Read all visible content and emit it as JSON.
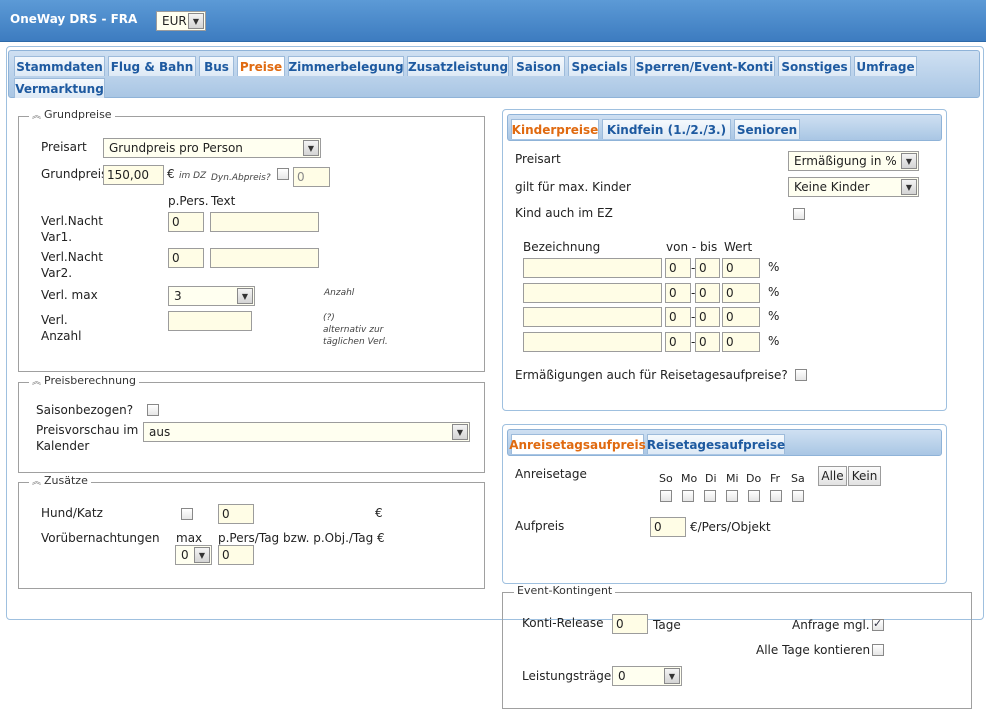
{
  "app": {
    "title": "OneWay DRS - FRA",
    "currency": "EUR"
  },
  "tabs": [
    {
      "label": "Stammdaten"
    },
    {
      "label": "Flug & Bahn"
    },
    {
      "label": "Bus"
    },
    {
      "label": "Preise",
      "active": true
    },
    {
      "label": "Zimmerbelegung"
    },
    {
      "label": "Zusatzleistung"
    },
    {
      "label": "Saison"
    },
    {
      "label": "Specials"
    },
    {
      "label": "Sperren/Event-Konti"
    },
    {
      "label": "Sonstiges"
    },
    {
      "label": "Umfrage"
    },
    {
      "label": "Vermarktung"
    }
  ],
  "grundpreise": {
    "legend": "Grundpreise",
    "preisart_label": "Preisart",
    "preisart_value": "Grundpreis pro Person",
    "grundpreis_label": "Grundpreis",
    "grundpreis_value": "150,00",
    "euro": "€",
    "im_dz": "im DZ",
    "dyn_label": "Dyn.Abpreis?",
    "dyn_value": "0",
    "col_ppers": "p.Pers.",
    "col_text": "Text",
    "var1_label_1": "Verl.Nacht",
    "var1_label_2": "Var1.",
    "var1_value": "0",
    "var2_label_1": "Verl.Nacht",
    "var2_label_2": "Var2.",
    "var2_value": "0",
    "verlmax_label": "Verl. max",
    "verlmax_value": "3",
    "anzahl_hint": "Anzahl",
    "verlanz_label_1": "Verl.",
    "verlanz_label_2": "Anzahl",
    "alt_hint_1": "(?)",
    "alt_hint_2": "alternativ zur",
    "alt_hint_3": "täglichen Verl."
  },
  "preisberechnung": {
    "legend": "Preisberechnung",
    "saison_label": "Saisonbezogen?",
    "vorschau_label_1": "Preisvorschau im",
    "vorschau_label_2": "Kalender",
    "vorschau_value": "aus"
  },
  "zusaetze": {
    "legend": "Zusätze",
    "hund_label": "Hund/Katz",
    "hund_value": "0",
    "euro": "€",
    "vor_label": "Vorübernachtungen",
    "max_label": "max",
    "max_value": "0",
    "per_label": "p.Pers/Tag bzw. p.Obj./Tag €",
    "per_value": "0"
  },
  "kinder": {
    "tabs": [
      {
        "label": "Kinderpreise",
        "active": true
      },
      {
        "label": "Kindfein (1./2./3.)"
      },
      {
        "label": "Senioren"
      }
    ],
    "preisart_label": "Preisart",
    "preisart_value": "Ermäßigung in %",
    "maxkinder_label": "gilt für max. Kinder",
    "maxkinder_value": "Keine Kinder",
    "ez_label": "Kind auch im EZ",
    "col_bez": "Bezeichnung",
    "col_vonbis": "von - bis",
    "col_wert": "Wert",
    "rows": [
      {
        "von": "0",
        "bis": "0",
        "wert": "0",
        "unit": "%"
      },
      {
        "von": "0",
        "bis": "0",
        "wert": "0",
        "unit": "%"
      },
      {
        "von": "0",
        "bis": "0",
        "wert": "0",
        "unit": "%"
      },
      {
        "von": "0",
        "bis": "0",
        "wert": "0",
        "unit": "%"
      }
    ],
    "reise_label": "Ermäßigungen auch für Reisetagesaufpreise?"
  },
  "anreise": {
    "tabs": [
      {
        "label": "Anreisetagsaufpreis",
        "active": true
      },
      {
        "label": "Reisetagesaufpreise"
      }
    ],
    "tage_label": "Anreisetage",
    "days": [
      "So",
      "Mo",
      "Di",
      "Mi",
      "Do",
      "Fr",
      "Sa"
    ],
    "alle": "Alle",
    "kein": "Kein",
    "aufpreis_label": "Aufpreis",
    "aufpreis_value": "0",
    "aufpreis_unit": "€/Pers/Objekt"
  },
  "event": {
    "legend": "Event-Kontingent",
    "release_label": "Konti-Release",
    "release_value": "0",
    "tage": "Tage",
    "anfrage_label": "Anfrage mgl.",
    "alle_tage_label": "Alle Tage kontieren",
    "traeger_label": "Leistungsträger",
    "traeger_value": "0"
  }
}
